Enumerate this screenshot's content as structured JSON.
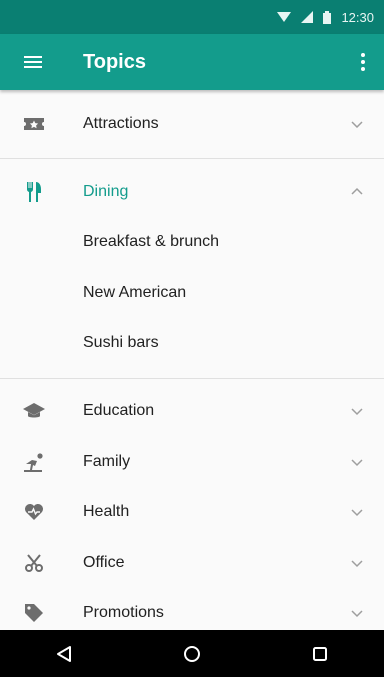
{
  "status_bar": {
    "time": "12:30",
    "icons": [
      "wifi-icon",
      "signal-icon",
      "battery-icon"
    ],
    "background": "#0a7f72"
  },
  "app_bar": {
    "title": "Topics",
    "background": "#139c8c",
    "left_icon": "menu-icon",
    "right_icon": "more-vert-icon"
  },
  "topics": {
    "attractions": {
      "label": "Attractions",
      "icon": "ticket-icon",
      "expanded": false
    },
    "dining": {
      "label": "Dining",
      "icon": "restaurant-icon",
      "expanded": true,
      "children": [
        "Breakfast & brunch",
        "New American",
        "Sushi bars"
      ]
    },
    "education": {
      "label": "Education",
      "icon": "school-icon",
      "expanded": false
    },
    "family": {
      "label": "Family",
      "icon": "family-icon",
      "expanded": false
    },
    "health": {
      "label": "Health",
      "icon": "heart-icon",
      "expanded": false
    },
    "office": {
      "label": "Office",
      "icon": "scissors-icon",
      "expanded": false
    },
    "promotions": {
      "label": "Promotions",
      "icon": "tag-icon",
      "expanded": false
    }
  },
  "colors": {
    "accent": "#139c8c",
    "icon_gray": "#6d6d6d",
    "chevron_gray": "#9e9e9e"
  },
  "nav_bar": {
    "buttons": [
      "back-icon",
      "home-icon",
      "recents-icon"
    ]
  }
}
